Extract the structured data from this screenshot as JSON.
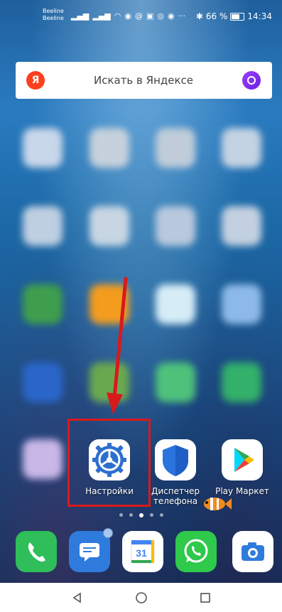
{
  "status_bar": {
    "carrier_1": "Beeline",
    "carrier_2": "Beeline",
    "battery": "66 %",
    "time": "14:34",
    "battery_level": 0.66
  },
  "search": {
    "logo": "Я",
    "placeholder": "Искать в Яндексе"
  },
  "apps": [
    {
      "name": "settings",
      "label": "Настройки"
    },
    {
      "name": "phone-manager",
      "label": "Диспетчер телефона"
    },
    {
      "name": "play-market",
      "label": "Play Маркет"
    }
  ],
  "dock": [
    {
      "name": "phone-app",
      "icon": "phone-icon"
    },
    {
      "name": "messages-app",
      "icon": "message-icon"
    },
    {
      "name": "calendar-app",
      "icon": "calendar-icon",
      "text": "31"
    },
    {
      "name": "whatsapp-app",
      "icon": "whatsapp-icon"
    },
    {
      "name": "camera-app",
      "icon": "camera-icon"
    }
  ],
  "pages": {
    "count": 5,
    "active": 3
  },
  "colors": {
    "highlight": "#d91a1a",
    "arrow": "#d91a1a"
  }
}
